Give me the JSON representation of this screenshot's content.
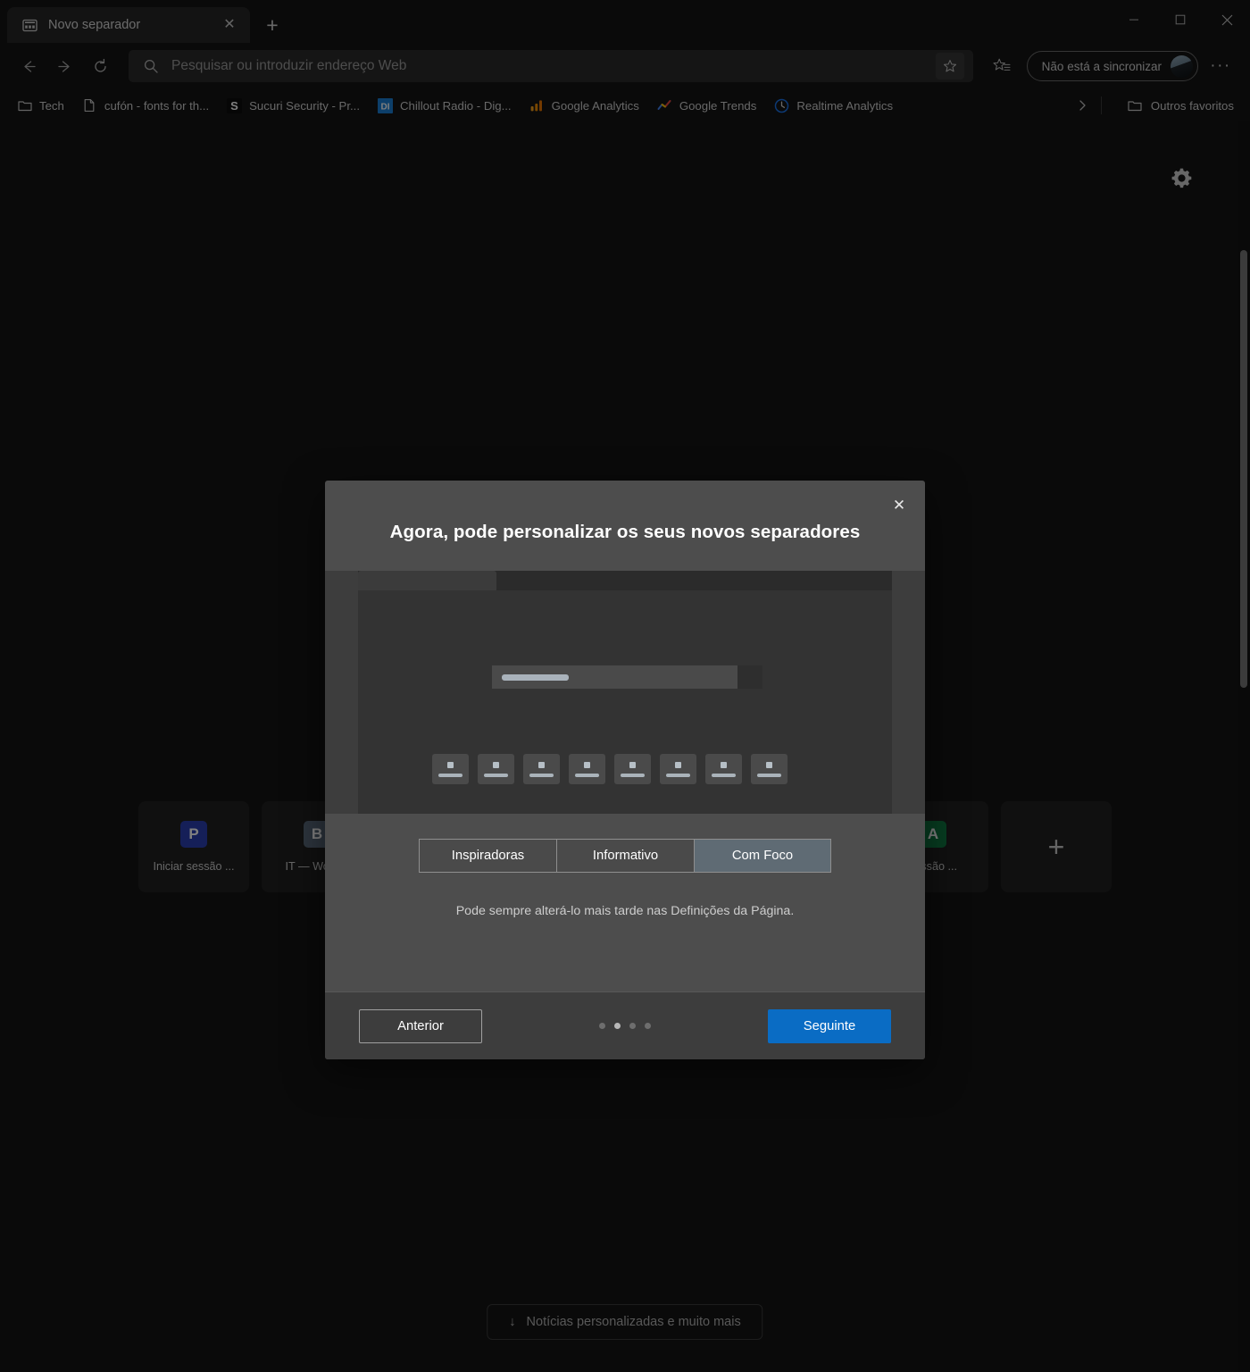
{
  "window": {
    "controls": [
      {
        "name": "minimize",
        "glyph": "minimize-icon"
      },
      {
        "name": "maximize",
        "glyph": "maximize-icon"
      },
      {
        "name": "close",
        "glyph": "close-icon"
      }
    ]
  },
  "tabs": {
    "active": {
      "title": "Novo separador",
      "favicon": "new-tab-page-icon",
      "close_label": "✕"
    },
    "new_tab_label": "+"
  },
  "toolbar": {
    "back_label": "←",
    "forward_label": "→",
    "refresh_label": "↻",
    "address": {
      "value": "",
      "placeholder": "Pesquisar ou introduzir endereço Web"
    },
    "favorite_icon": "star-icon",
    "collections_icon": "collections-icon",
    "profile": {
      "label": "Não está a sincronizar",
      "avatar": "user-avatar"
    },
    "more_label": "···"
  },
  "bookmarks": {
    "items": [
      {
        "label": "Tech",
        "icon": "folder-icon",
        "icon_color": "#c9c9c9"
      },
      {
        "label": "cufón - fonts for th...",
        "icon": "page-icon",
        "icon_color": "#c9c9c9"
      },
      {
        "label": "Sucuri Security - Pr...",
        "icon": "letter-s-favicon",
        "icon_color": "#111111"
      },
      {
        "label": "Chillout Radio - Dig...",
        "icon": "di-favicon",
        "icon_color": "#1a7fd4"
      },
      {
        "label": "Google Analytics",
        "icon": "bar-chart-favicon",
        "icon_color": "#f29900"
      },
      {
        "label": "Google Trends",
        "icon": "trend-line-favicon",
        "icon_color": "#4285f4"
      },
      {
        "label": "Realtime Analytics",
        "icon": "clock-favicon",
        "icon_color": "#1a73e8"
      }
    ],
    "overflow_label": "›",
    "other_favorites": {
      "label": "Outros favoritos",
      "icon": "folder-icon"
    }
  },
  "newtab": {
    "settings_icon": "gear-icon",
    "tiles": [
      {
        "badge": "P",
        "badge_bg": "#2b3fb0",
        "label": "Iniciar sessão ..."
      },
      {
        "badge": "B",
        "badge_bg": "#5b6b7d",
        "label": "IT — Word..."
      },
      {
        "badge": "A",
        "badge_bg": "#0f7a43",
        "label": "sessão ..."
      }
    ],
    "add_tile_label": "+",
    "news_pill": {
      "arrow": "↓",
      "label": "Notícias personalizadas e muito mais"
    }
  },
  "modal": {
    "close_label": "✕",
    "title": "Agora, pode personalizar os seus novos separadores",
    "preview": {
      "tile_count": 8,
      "name": "new-tab-layout-preview"
    },
    "segmented": {
      "options": [
        {
          "label": "Inspiradoras",
          "selected": false
        },
        {
          "label": "Informativo",
          "selected": false
        },
        {
          "label": "Com Foco",
          "selected": true
        }
      ],
      "selected_value": "Com Foco"
    },
    "hint": "Pode sempre alterá-lo mais tarde nas Definições da Página.",
    "footer": {
      "previous_label": "Anterior",
      "next_label": "Seguinte",
      "page_count": 4,
      "current_page": 2
    },
    "accent_color": "#0a6cc4"
  }
}
